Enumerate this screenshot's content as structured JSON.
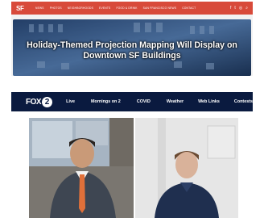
{
  "top_site": {
    "logo": "SF",
    "menu": [
      "NEWS",
      "PHOTOS",
      "NEIGHBORHOODS",
      "EVENTS",
      "FOOD & DRINK",
      "SAN FRANCISCO NEWS",
      "CONTACT"
    ],
    "social_icons": [
      "facebook-icon",
      "twitter-icon",
      "instagram-icon",
      "search-icon"
    ],
    "headline_line1": "Holiday-Themed Projection Mapping Will Display on",
    "headline_line2": "Downtown SF Buildings",
    "colors": {
      "nav": "#d84a3a",
      "hero_tint": "#5b84b8"
    }
  },
  "fox_site": {
    "logo_text": "FOX",
    "logo_number": "2",
    "menu": [
      "Live",
      "Mornings on 2",
      "COVID",
      "Weather",
      "Web Links",
      "Contests"
    ],
    "colors": {
      "nav": "#0a1a3f"
    }
  }
}
